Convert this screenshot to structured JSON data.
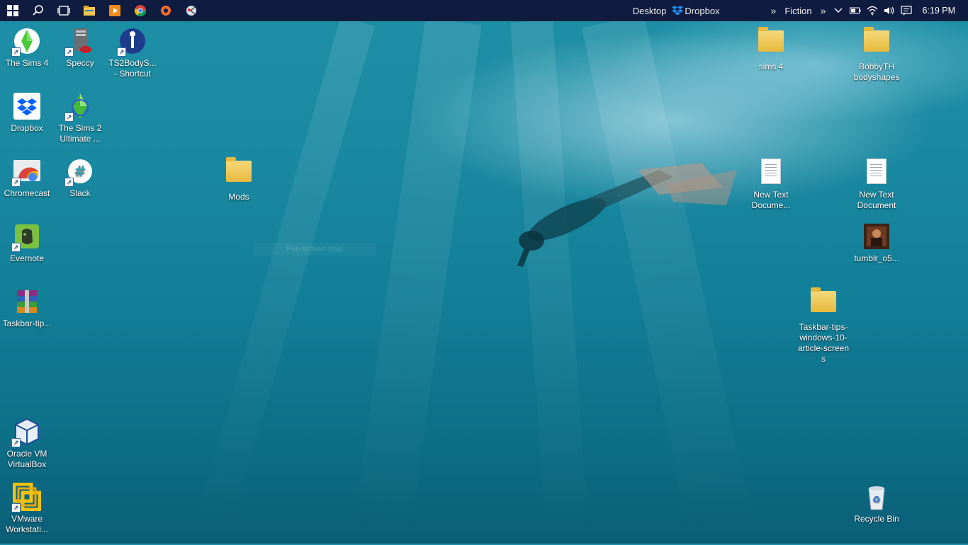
{
  "taskbar": {
    "right": {
      "desktop_label": "Desktop",
      "dropbox_label": "Dropbox",
      "chevron1": "»",
      "fiction_label": "Fiction",
      "chevron2": "»",
      "time": "6:19 PM"
    }
  },
  "desktop": {
    "left_icons": [
      {
        "label": "The Sims 4"
      },
      {
        "label": "Speccy"
      },
      {
        "label": "TS2BodyS... - Shortcut"
      },
      {
        "label": "Dropbox"
      },
      {
        "label": "The Sims 2 Ultimate ..."
      },
      {
        "label": "Chromecast"
      },
      {
        "label": "Slack"
      },
      {
        "label": "Mods"
      },
      {
        "label": "Evernote"
      },
      {
        "label": "Taskbar-tip..."
      },
      {
        "label": "Oracle VM VirtualBox"
      },
      {
        "label": "VMware Workstati..."
      }
    ],
    "right_icons": [
      {
        "label": "sims 4"
      },
      {
        "label": "BobbyTH bodyshapes"
      },
      {
        "label": "New Text Docume..."
      },
      {
        "label": "New Text Document"
      },
      {
        "label": "tumblr_o5..."
      },
      {
        "label": "Taskbar-tips-windows-10-article-screens"
      },
      {
        "label": "Recycle Bin"
      }
    ],
    "overlay_text": "Full-screen Snip"
  },
  "colors": {
    "taskbar_bg": "#101c3f",
    "accent_blue": "#0061fe"
  }
}
